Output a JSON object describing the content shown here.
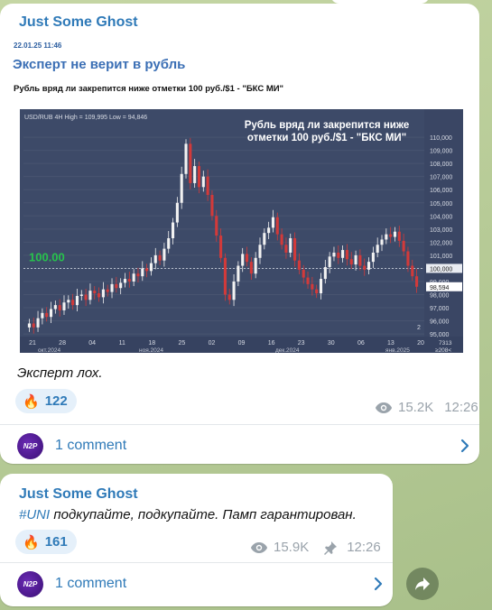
{
  "post1": {
    "channel": "Just Some Ghost",
    "doc_date": "22.01.25 11:46",
    "doc_title": "Эксперт не верит в рубль",
    "doc_subtitle": "Рубль вряд ли закрепится ниже отметки 100 руб./$1 - \"БКС МИ\"",
    "caption": "Эксперт лох.",
    "reaction": {
      "emoji": "🔥",
      "count": "122"
    },
    "views": "15.2K",
    "time": "12:26",
    "comments": "1 comment"
  },
  "post2": {
    "channel": "Just Some Ghost",
    "hashtag": "#UNI",
    "text": " подкупайте, подкупайте. Памп гарантирован.",
    "reaction": {
      "emoji": "🔥",
      "count": "161"
    },
    "views": "15.9K",
    "time": "12:26",
    "comments": "1 comment"
  },
  "avatar_text": "N2P",
  "colors": {
    "accent": "#2f7ab8",
    "chart_bg": "#3d4a68",
    "up": "#f2f2f2",
    "down": "#d23a3a",
    "level": "#27c24c"
  },
  "chart_data": {
    "type": "candlestick",
    "header": "USD/RUB 4H High = 109,995 Low = 94,846",
    "title_lines": [
      "Рубль вряд ли закрепится ниже",
      "отметки 100 руб./$1 - \"БКС МИ\""
    ],
    "level_label": "100.00",
    "current_label": "98,594",
    "level_value": 100.0,
    "ylim": [
      94.8,
      110.9
    ],
    "y_ticks": [
      "110,000",
      "109,000",
      "108,000",
      "107,000",
      "106,000",
      "105,000",
      "104,000",
      "103,000",
      "102,000",
      "101,000",
      "100,000",
      "99,000",
      "98,000",
      "97,000",
      "96,000",
      "95,000"
    ],
    "x_ticks": [
      "21",
      "28",
      "04",
      "11",
      "18",
      "25",
      "02",
      "09",
      "16",
      "23",
      "30",
      "06",
      "13",
      "20"
    ],
    "month_labels": [
      "окт.2024",
      "ноя.2024",
      "дек.2024",
      "янв.2025"
    ],
    "corner_labels": [
      "2",
      "7313",
      "≥208<"
    ],
    "close_series": [
      95.8,
      95.5,
      96.2,
      96.6,
      96.3,
      96.9,
      97.2,
      96.8,
      97.4,
      97.6,
      97.2,
      97.9,
      98.0,
      97.6,
      98.3,
      98.1,
      97.8,
      98.4,
      98.2,
      98.8,
      98.5,
      98.9,
      99.2,
      99.0,
      99.6,
      99.4,
      100.0,
      99.8,
      100.4,
      101.0,
      100.6,
      101.5,
      102.3,
      103.5,
      105.0,
      107.2,
      109.5,
      106.5,
      107.8,
      106.2,
      107.0,
      105.6,
      104.0,
      102.5,
      100.8,
      98.0,
      97.6,
      99.0,
      100.2,
      101.1,
      100.5,
      99.6,
      100.8,
      101.8,
      102.7,
      103.1,
      103.9,
      102.6,
      101.8,
      101.2,
      102.3,
      100.6,
      99.9,
      99.3,
      98.8,
      98.4,
      98.1,
      99.2,
      100.1,
      100.9,
      101.2,
      100.8,
      101.4,
      100.7,
      100.3,
      101.0,
      100.2,
      99.9,
      100.5,
      101.2,
      101.8,
      102.2,
      102.6,
      102.4,
      102.8,
      102.1,
      101.3,
      100.2,
      99.4,
      98.6
    ]
  }
}
